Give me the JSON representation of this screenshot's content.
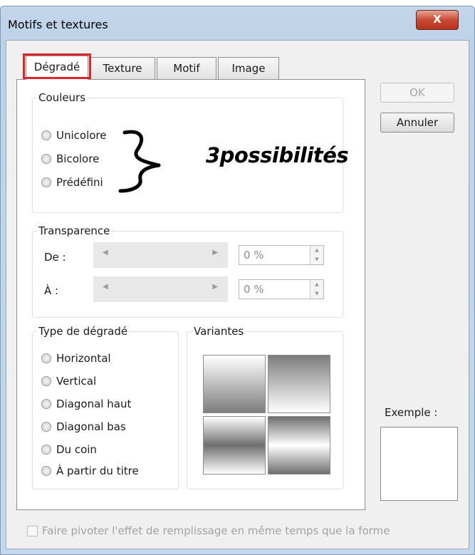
{
  "window": {
    "title": "Motifs et textures",
    "close_glyph": "X"
  },
  "tabs": [
    {
      "label": "Dégradé",
      "active": true
    },
    {
      "label": "Texture",
      "active": false
    },
    {
      "label": "Motif",
      "active": false
    },
    {
      "label": "Image",
      "active": false
    }
  ],
  "couleurs": {
    "label": "Couleurs",
    "options": [
      "Unicolore",
      "Bicolore",
      "Prédéfini"
    ]
  },
  "annotation": {
    "text": "3possibilités"
  },
  "transparence": {
    "label": "Transparence",
    "de_label": "De :",
    "a_label": "À :",
    "de_value": "0 %",
    "a_value": "0 %"
  },
  "type_degrade": {
    "label": "Type de dégradé",
    "options": [
      "Horizontal",
      "Vertical",
      "Diagonal haut",
      "Diagonal bas",
      "Du coin",
      "À partir du titre"
    ]
  },
  "variantes": {
    "label": "Variantes"
  },
  "buttons": {
    "ok": "OK",
    "cancel": "Annuler"
  },
  "example": {
    "label": "Exemple :"
  },
  "rotate_checkbox": {
    "label": "Faire pivoter l'effet de remplissage en même temps que la forme",
    "checked": false
  },
  "colors": {
    "highlight": "#d9262e",
    "title_bar": "#bcd1e8",
    "close_button": "#c84a34"
  }
}
